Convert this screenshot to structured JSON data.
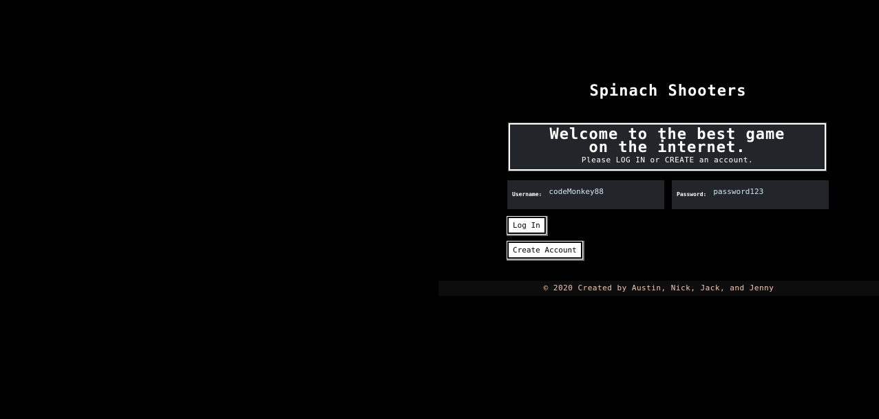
{
  "title": "Spinach Shooters",
  "banner": {
    "line1": "Welcome to the best game",
    "line2": "on the internet.",
    "subtitle": "Please LOG IN or CREATE an account."
  },
  "login_form": {
    "username_label": "Username:",
    "username_value": "codeMonkey88",
    "password_label": "Password:",
    "password_value": "password123"
  },
  "buttons": {
    "login": "Log In",
    "create_account": "Create Account"
  },
  "footer": {
    "text": "© 2020 Created by Austin, Nick, Jack, and Jenny"
  },
  "colors": {
    "background": "#000000",
    "panel": "#22262a",
    "footer_text": "#f0c8b0"
  }
}
